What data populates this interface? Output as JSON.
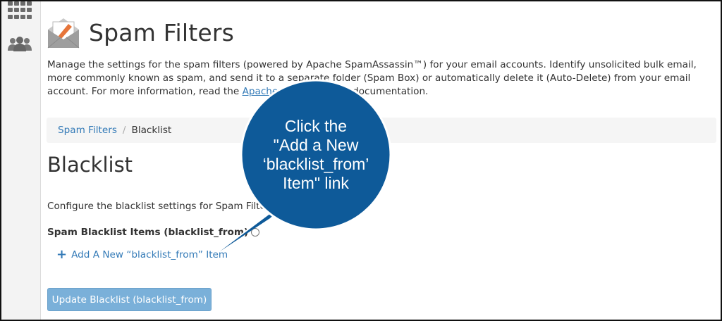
{
  "page": {
    "title": "Spam Filters",
    "description_text": "Manage the settings for the spam filters (powered by Apache SpamAssassin™) for your email accounts. Identify unsolicited bulk email, more commonly known as spam, and send it to a separate folder (Spam Box) or automatically delete it (Auto-Delete) from your email account. For more information, read the ",
    "description_link": "Apache SpamAssassin",
    "description_tail": " documentation."
  },
  "breadcrumb": {
    "parent": "Spam Filters",
    "separator": "/",
    "current": "Blacklist"
  },
  "section": {
    "title": "Blacklist",
    "configure_text": "Configure the blacklist settings for Spam Filters.",
    "items_label": "Spam Blacklist Items (blacklist_from)",
    "add_link": "Add A New “blacklist_from” Item",
    "update_button": "Update Blacklist (blacklist_from)"
  },
  "callout": {
    "line1": "Click the",
    "line2": "\"Add a New",
    "line3": "‘blacklist_from’",
    "line4": "Item\" link",
    "color": "#0e5a99"
  },
  "icons": [
    "apps-grid-icon",
    "users-icon",
    "spam-filters-envelope-icon",
    "info-icon",
    "plus-icon"
  ]
}
